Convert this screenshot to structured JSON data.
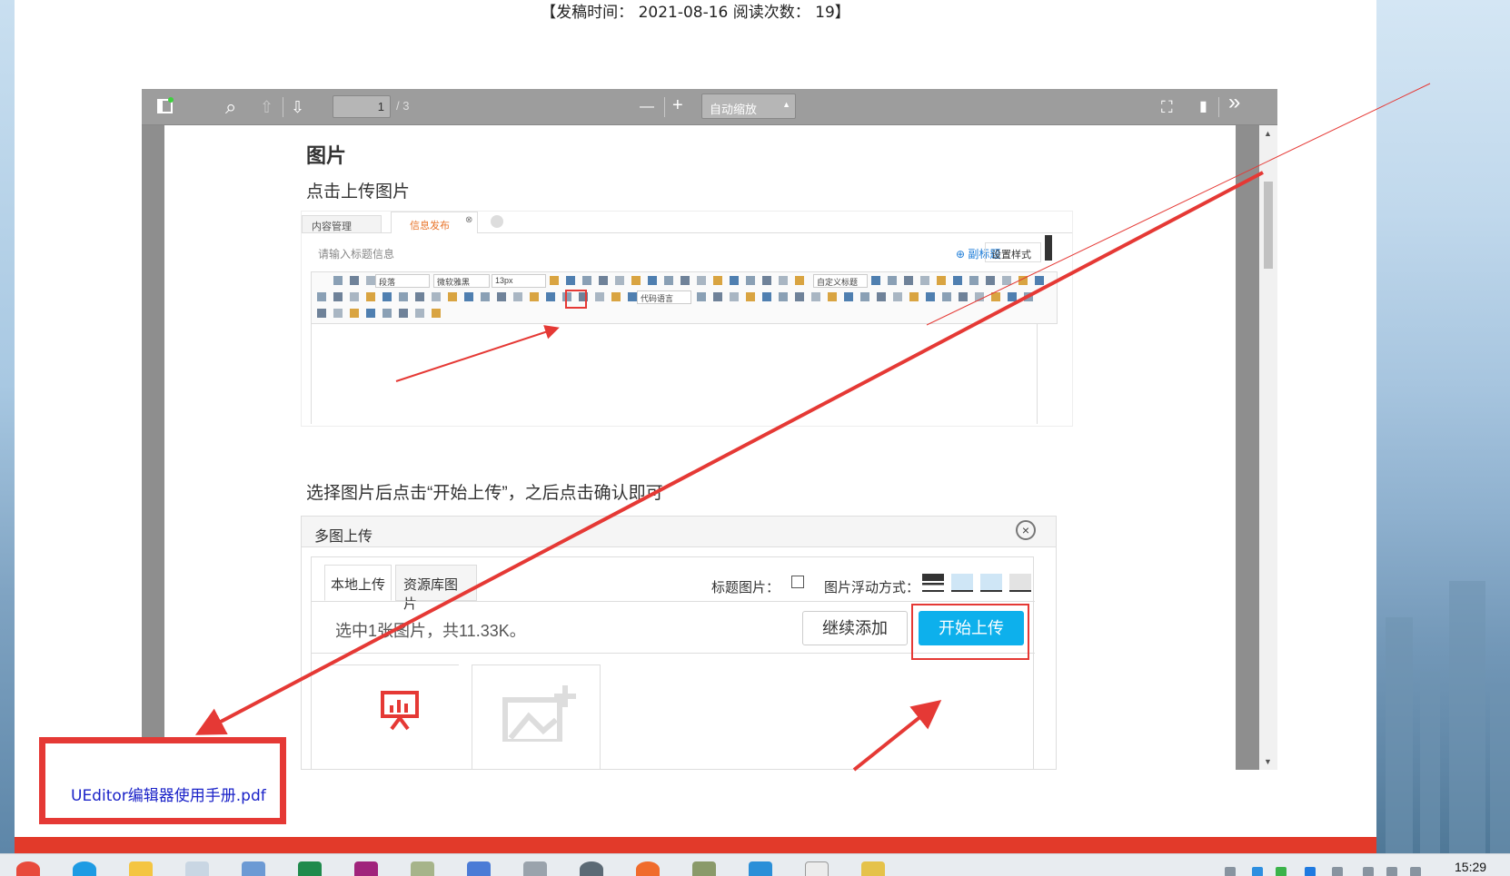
{
  "meta_line": "【发稿时间： 2021-08-16  阅读次数： 19】",
  "viewer": {
    "page_current": "1",
    "page_total": "/ 3",
    "zoom_select": "自动缩放",
    "icons": [
      "sidebar-toggle-icon",
      "search-icon",
      "prev-page-icon",
      "next-page-icon",
      "zoom-out-icon",
      "zoom-in-icon",
      "fullscreen-icon",
      "bookmark-icon",
      "more-tools-icon"
    ],
    "toolbar_glyphs": {
      "search": "⌕",
      "up": "⇧",
      "down": "⇩",
      "minus": "—",
      "plus": "+",
      "fullscreen": "⛶",
      "bookmark": "▮",
      "more": "»"
    }
  },
  "pdf": {
    "heading": "图片",
    "para1": "点击上传图片",
    "para2": "选择图片后点击“开始上传”，之后点击确认即可",
    "editor": {
      "tab1": "内容管理",
      "tab2": "信息发布",
      "tab2_close": "⊗",
      "title_placeholder": "请输入标题信息",
      "subtitle_link": "⊕ 副标题",
      "style_button": "设置样式",
      "toolbar_selects": [
        "段落",
        "微软雅黑",
        "13px",
        "自定义标题",
        "代码语言"
      ]
    },
    "dialog": {
      "title": "多图上传",
      "close": "×",
      "tab_local": "本地上传",
      "tab_library": "资源库图片",
      "title_image_label": "标题图片：",
      "float_label": "图片浮动方式：",
      "status": "选中1张图片，共11.33K。",
      "continue_button": "继续添加",
      "start_button": "开始上传"
    }
  },
  "attachment_link": "UEditor编辑器使用手册.pdf",
  "taskbar": {
    "clock": "15:29"
  },
  "colors": {
    "accent_red": "#e53935",
    "upload_blue": "#0db0ec",
    "link_blue": "#1a22c8",
    "footer_red": "#e23a2a"
  }
}
